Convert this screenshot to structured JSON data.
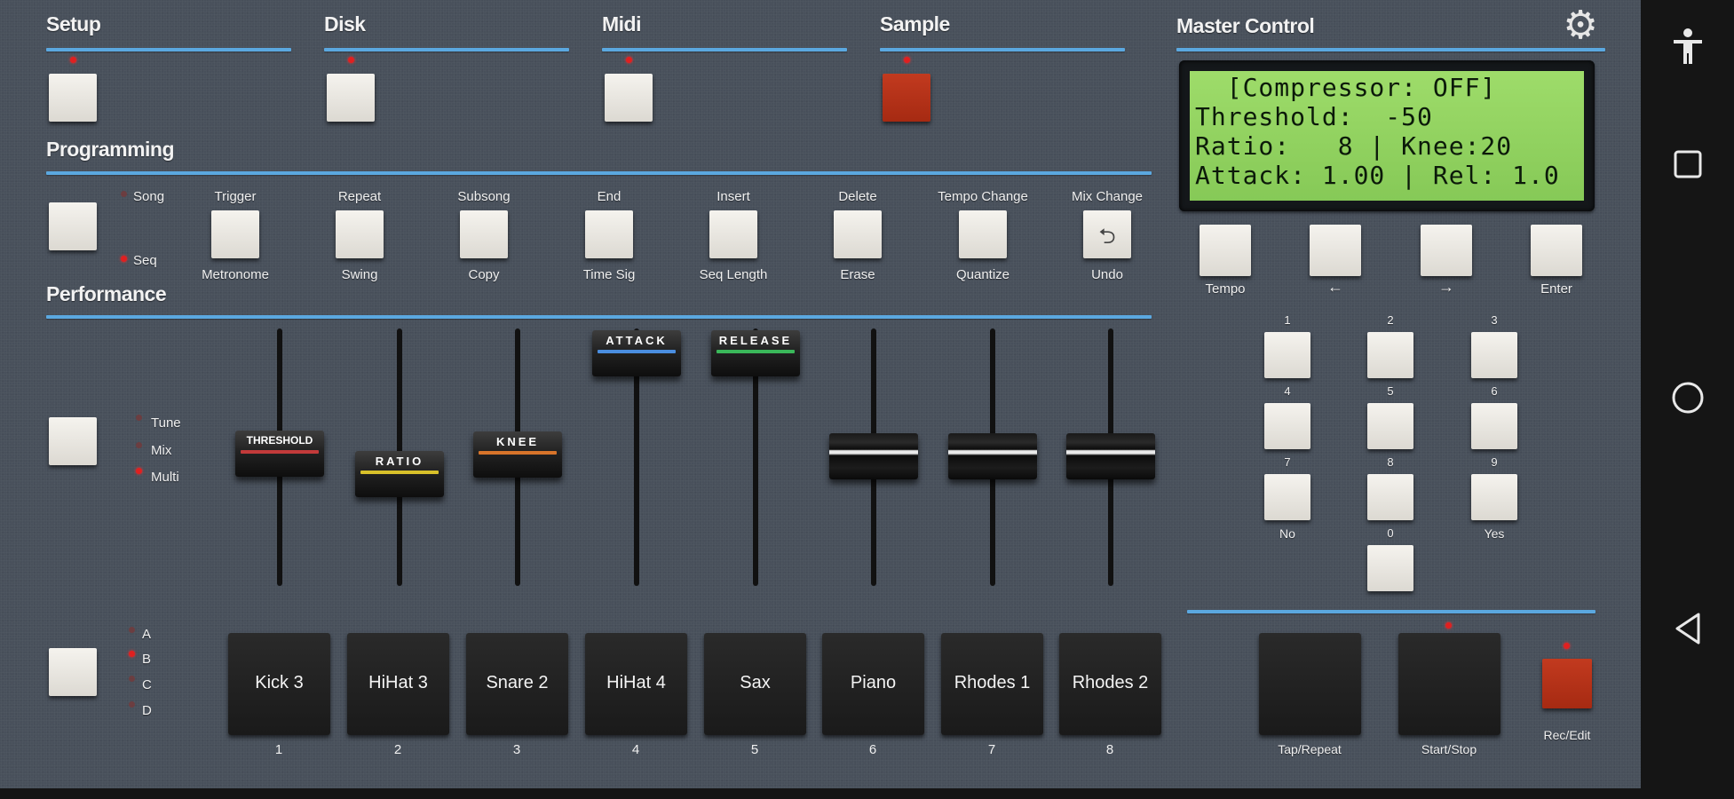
{
  "sections": {
    "setup": "Setup",
    "disk": "Disk",
    "midi": "Midi",
    "sample": "Sample",
    "master": "Master Control",
    "programming": "Programming",
    "performance": "Performance"
  },
  "programming": {
    "mode_options": [
      "Song",
      "Seq"
    ],
    "top_labels": [
      "Trigger",
      "Repeat",
      "Subsong",
      "End",
      "Insert",
      "Delete",
      "Tempo Change",
      "Mix Change"
    ],
    "bottom_labels": [
      "Metronome",
      "Swing",
      "Copy",
      "Time Sig",
      "Seq Length",
      "Erase",
      "Quantize",
      "Undo"
    ]
  },
  "performance": {
    "mode_options": [
      "Tune",
      "Mix",
      "Multi"
    ],
    "fader_labels": [
      "THRESHOLD",
      "RATIO",
      "KNEE",
      "ATTACK",
      "RELEASE"
    ],
    "bank_options": [
      "A",
      "B",
      "C",
      "D"
    ]
  },
  "pads": [
    {
      "name": "Kick 3",
      "num": "1"
    },
    {
      "name": "HiHat 3",
      "num": "2"
    },
    {
      "name": "Snare 2",
      "num": "3"
    },
    {
      "name": "HiHat 4",
      "num": "4"
    },
    {
      "name": "Sax",
      "num": "5"
    },
    {
      "name": "Piano",
      "num": "6"
    },
    {
      "name": "Rhodes 1",
      "num": "7"
    },
    {
      "name": "Rhodes 2",
      "num": "8"
    }
  ],
  "lcd": {
    "line1": "  [Compressor: OFF]",
    "line2": "Threshold:  -50",
    "line3": "Ratio:   8 | Knee:20",
    "line4": "Attack: 1.00 | Rel: 1.0"
  },
  "master": {
    "nav_labels": [
      "Tempo",
      "←",
      "→",
      "Enter"
    ],
    "keypad": [
      "1",
      "2",
      "3",
      "4",
      "5",
      "6",
      "7",
      "8",
      "9",
      "0"
    ],
    "no": "No",
    "yes": "Yes",
    "transport": [
      "Tap/Repeat",
      "Start/Stop",
      "Rec/Edit"
    ]
  },
  "colors": {
    "panel": "#48505b",
    "accent_line": "#5ba8e0",
    "led_red": "#e02020",
    "sample_button": "#b5321a",
    "lcd_green": "#92d461"
  },
  "icons": {
    "settings": "gear-icon",
    "undo": "undo-icon",
    "nav": [
      "accessibility-icon",
      "recents-icon",
      "home-icon",
      "back-icon"
    ]
  }
}
